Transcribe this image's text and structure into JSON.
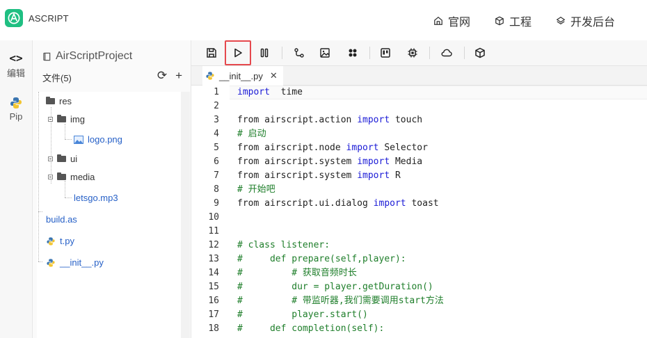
{
  "app": {
    "name": "ASCRIPT",
    "brand_color": "#1fbf82"
  },
  "nav": [
    {
      "label": "官网",
      "icon": "home-icon"
    },
    {
      "label": "工程",
      "icon": "cube-icon"
    },
    {
      "label": "开发后台",
      "icon": "layers-icon"
    }
  ],
  "activity": [
    {
      "label": "编辑",
      "icon": "code-icon"
    },
    {
      "label": "Pip",
      "icon": "python-icon"
    }
  ],
  "explorer": {
    "project": "AirScriptProject",
    "files_label": "文件(5)",
    "refresh_icon": "refresh-icon",
    "add_icon": "plus-icon",
    "tree": [
      {
        "label": "res",
        "type": "folder"
      },
      {
        "label": "img",
        "type": "folder"
      },
      {
        "label": "logo.png",
        "type": "image"
      },
      {
        "label": "ui",
        "type": "folder"
      },
      {
        "label": "media",
        "type": "folder"
      },
      {
        "label": "letsgo.mp3",
        "type": "file"
      },
      {
        "label": "build.as",
        "type": "file"
      },
      {
        "label": "t.py",
        "type": "python"
      },
      {
        "label": "__init__.py",
        "type": "python"
      }
    ]
  },
  "toolbar": {
    "buttons": [
      "save-icon",
      "run-icon",
      "pause-icon",
      "node-icon",
      "image-icon",
      "plugin-icon",
      "board-icon",
      "chip-icon",
      "cloud-icon",
      "package-icon"
    ],
    "highlighted": "run-icon",
    "highlight_color": "#e5484d"
  },
  "tabs": [
    {
      "label": "__init__.py",
      "close": "✕"
    }
  ],
  "editor": {
    "lines": [
      {
        "n": "1",
        "parts": [
          [
            "kw",
            "import"
          ],
          [
            "",
            "  time"
          ]
        ]
      },
      {
        "n": "2",
        "parts": []
      },
      {
        "n": "3",
        "parts": [
          [
            "",
            "from airscript.action "
          ],
          [
            "kw",
            "import"
          ],
          [
            "",
            "",
            " touch"
          ]
        ]
      },
      {
        "n": "4",
        "parts": [
          [
            "cm",
            "# 启动"
          ]
        ]
      },
      {
        "n": "5",
        "parts": [
          [
            "",
            "from airscript.node "
          ],
          [
            "kw",
            "import"
          ],
          [
            "",
            " Selector"
          ]
        ]
      },
      {
        "n": "6",
        "parts": [
          [
            "",
            "from airscript.system "
          ],
          [
            "kw",
            "import"
          ],
          [
            "",
            " Media"
          ]
        ]
      },
      {
        "n": "7",
        "parts": [
          [
            "",
            "from airscript.system "
          ],
          [
            "kw",
            "import"
          ],
          [
            "",
            " R"
          ]
        ]
      },
      {
        "n": "8",
        "parts": [
          [
            "cm",
            "# 开始吧"
          ]
        ]
      },
      {
        "n": "9",
        "parts": [
          [
            "",
            "from airscript.ui.dialog "
          ],
          [
            "kw",
            "import"
          ],
          [
            "",
            " toast"
          ]
        ]
      },
      {
        "n": "10",
        "parts": []
      },
      {
        "n": "11",
        "parts": []
      },
      {
        "n": "12",
        "parts": [
          [
            "cm",
            "# class listener:"
          ]
        ]
      },
      {
        "n": "13",
        "parts": [
          [
            "cm",
            "#     def prepare(self,player):"
          ]
        ]
      },
      {
        "n": "14",
        "parts": [
          [
            "cm",
            "#         # 获取音频时长"
          ]
        ]
      },
      {
        "n": "15",
        "parts": [
          [
            "cm",
            "#         dur = player.getDuration()"
          ]
        ]
      },
      {
        "n": "16",
        "parts": [
          [
            "cm",
            "#         # 带监听器,我们需要调用start方法"
          ]
        ]
      },
      {
        "n": "17",
        "parts": [
          [
            "cm",
            "#         player.start()"
          ]
        ]
      },
      {
        "n": "18",
        "parts": [
          [
            "cm",
            "#     def completion(self):"
          ]
        ]
      }
    ],
    "keyword_color": "#1a1ad6",
    "comment_color": "#1e7e2a"
  }
}
